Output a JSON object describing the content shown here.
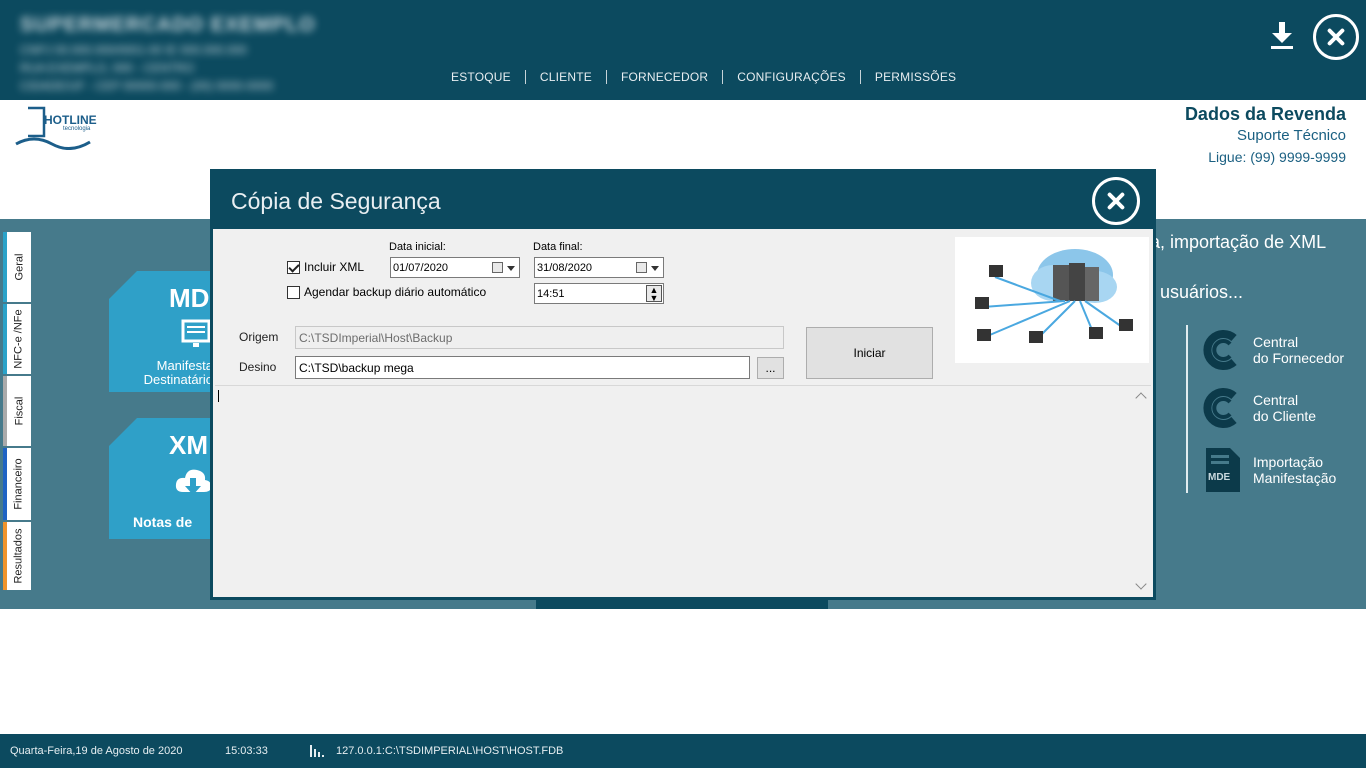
{
  "topbar": {
    "company_blurred": [
      "SUPERMERCADO EXEMPLO",
      "CNPJ 00.000.000/0001-00     IE 000.000.000",
      "RUA EXEMPLO, 000 - CENTRO",
      "CIDADE/UF - CEP 00000-000 - (00) 0000-0000"
    ],
    "nav": [
      "ESTOQUE",
      "CLIENTE",
      "FORNECEDOR",
      "CONFIGURAÇÕES",
      "PERMISSÕES"
    ]
  },
  "logo": {
    "name": "HOTLINE",
    "tagline": "tecnologia"
  },
  "reseller": {
    "title": "Dados da Revenda",
    "support": "Suporte Técnico",
    "phone": "Ligue: (99) 9999-9999"
  },
  "side_tabs": [
    {
      "label": "Geral",
      "color": "#2ba3c9"
    },
    {
      "label": "NFC-e /NFe",
      "color": "#2ba3c9"
    },
    {
      "label": "Fiscal",
      "color": "#aaaaaa"
    },
    {
      "label": "Financeiro",
      "color": "#1f63c4"
    },
    {
      "label": "Resultados",
      "color": "#f0942b"
    }
  ],
  "cards": {
    "card1": {
      "title": "MD",
      "line1": "Manifesta",
      "line2": "Destinatário"
    },
    "card2": {
      "title": "XM",
      "bottom": "Notas de"
    }
  },
  "background_text": [
    "a, importação de XML",
    ",",
    ", usuários..."
  ],
  "links": [
    {
      "line1": "Central",
      "line2": "do Fornecedor"
    },
    {
      "line1": "Central",
      "line2": "do Cliente"
    },
    {
      "line1": "Importação",
      "line2": "Manifestação",
      "badge": "MDE"
    }
  ],
  "dialog": {
    "title": "Cópia de Segurança",
    "include_xml": {
      "label": "Incluir XML",
      "checked": true
    },
    "schedule": {
      "label": "Agendar backup diário automático",
      "checked": false
    },
    "start_date": {
      "label": "Data inicial:",
      "value": "01/07/2020"
    },
    "end_date": {
      "label": "Data final:",
      "value": "31/08/2020"
    },
    "time": "14:51",
    "origin": {
      "label": "Origem",
      "value": "C:\\TSDImperial\\Host\\Backup"
    },
    "destination": {
      "label": "Desino",
      "value": "C:\\TSD\\backup mega"
    },
    "browse_label": "...",
    "start_button": "Iniciar"
  },
  "status": {
    "date": "Quarta-Feira,19 de Agosto de 2020",
    "time": "15:03:33",
    "db": "127.0.0.1:C:\\TSDIMPERIAL\\HOST\\HOST.FDB"
  },
  "colors": {
    "primary": "#0c4a5f",
    "main_bg": "#467a8b",
    "card": "#2fa0c8"
  }
}
